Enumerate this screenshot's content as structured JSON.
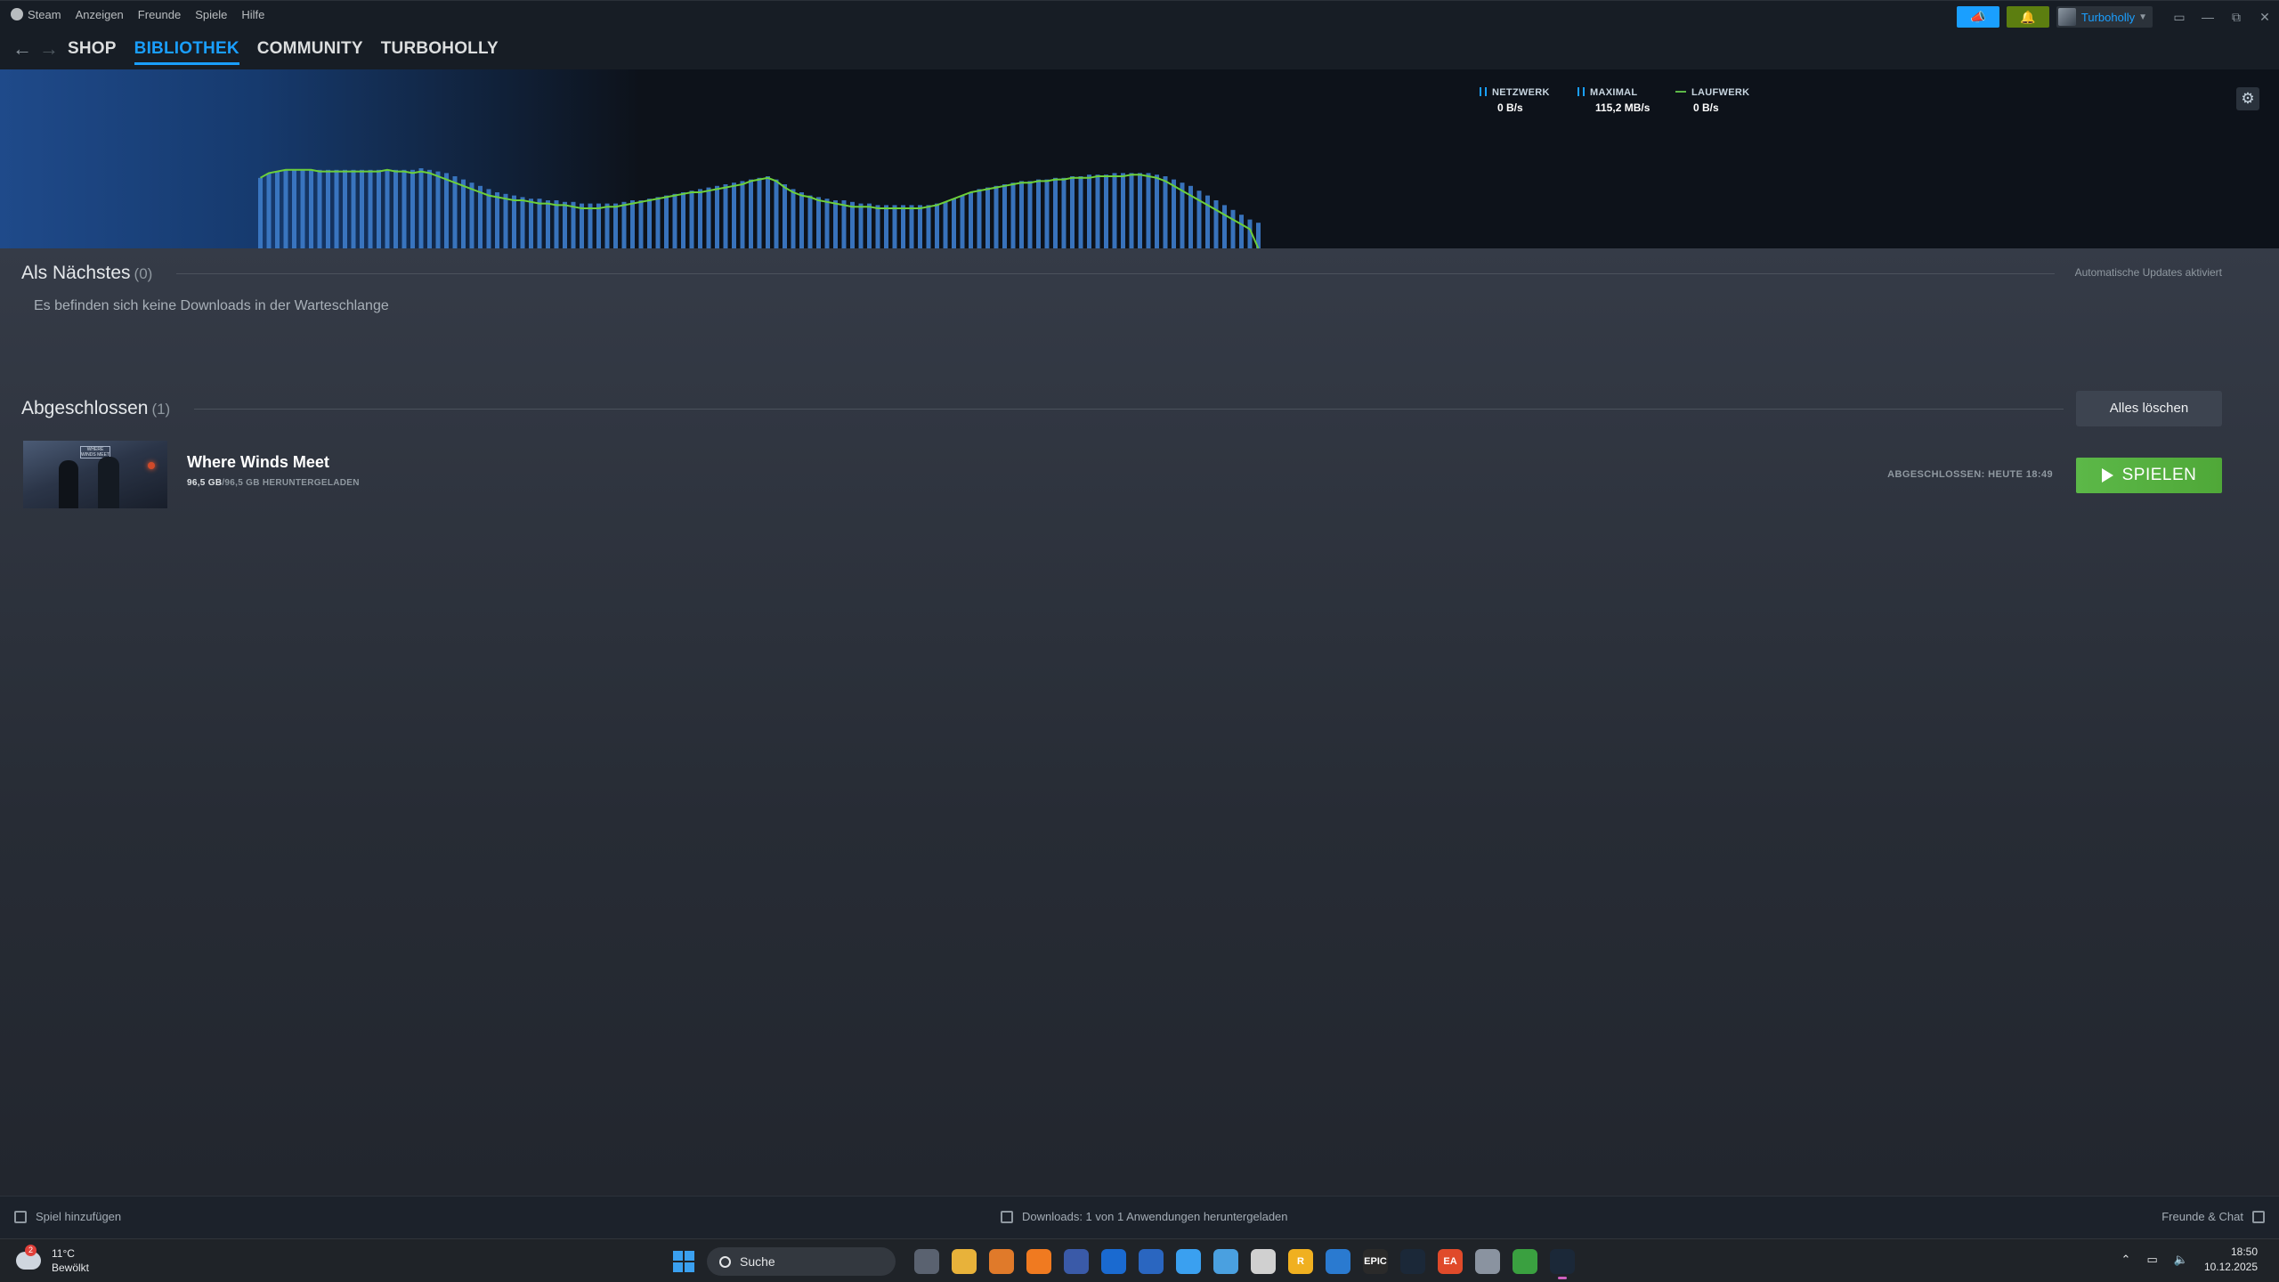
{
  "menu": {
    "steam": "Steam",
    "items": [
      "Anzeigen",
      "Freunde",
      "Spiele",
      "Hilfe"
    ]
  },
  "user": {
    "name": "Turboholly"
  },
  "nav": {
    "tabs": [
      "SHOP",
      "BIBLIOTHEK",
      "COMMUNITY",
      "TURBOHOLLY"
    ],
    "active": "BIBLIOTHEK"
  },
  "graph": {
    "legend": [
      {
        "label": "NETZWERK",
        "value": "0 B/s",
        "color": "#1a9fff"
      },
      {
        "label": "MAXIMAL",
        "value": "115,2 MB/s",
        "color": "#1a9fff"
      },
      {
        "label": "LAUFWERK",
        "value": "0 B/s",
        "color": "#5cb848"
      }
    ],
    "network_levels": [
      0.44,
      0.47,
      0.48,
      0.49,
      0.49,
      0.49,
      0.49,
      0.49,
      0.49,
      0.49,
      0.49,
      0.49,
      0.49,
      0.49,
      0.49,
      0.49,
      0.49,
      0.49,
      0.49,
      0.5,
      0.49,
      0.48,
      0.47,
      0.45,
      0.43,
      0.41,
      0.39,
      0.37,
      0.35,
      0.34,
      0.33,
      0.32,
      0.31,
      0.31,
      0.3,
      0.3,
      0.29,
      0.29,
      0.28,
      0.28,
      0.28,
      0.28,
      0.28,
      0.29,
      0.3,
      0.3,
      0.31,
      0.32,
      0.33,
      0.34,
      0.35,
      0.36,
      0.37,
      0.38,
      0.39,
      0.4,
      0.41,
      0.42,
      0.43,
      0.44,
      0.45,
      0.43,
      0.4,
      0.37,
      0.35,
      0.33,
      0.32,
      0.31,
      0.3,
      0.3,
      0.29,
      0.28,
      0.28,
      0.27,
      0.27,
      0.27,
      0.27,
      0.27,
      0.27,
      0.27,
      0.28,
      0.29,
      0.31,
      0.33,
      0.35,
      0.37,
      0.38,
      0.39,
      0.4,
      0.41,
      0.42,
      0.42,
      0.43,
      0.43,
      0.44,
      0.44,
      0.45,
      0.45,
      0.46,
      0.46,
      0.46,
      0.47,
      0.47,
      0.47,
      0.47,
      0.47,
      0.46,
      0.45,
      0.43,
      0.41,
      0.39,
      0.36,
      0.33,
      0.3,
      0.27,
      0.24,
      0.21,
      0.18,
      0.16
    ],
    "disk_levels": [
      0.44,
      0.47,
      0.48,
      0.49,
      0.49,
      0.49,
      0.49,
      0.48,
      0.48,
      0.48,
      0.48,
      0.48,
      0.48,
      0.48,
      0.48,
      0.49,
      0.48,
      0.48,
      0.47,
      0.48,
      0.47,
      0.45,
      0.43,
      0.41,
      0.39,
      0.37,
      0.35,
      0.33,
      0.32,
      0.31,
      0.3,
      0.3,
      0.29,
      0.28,
      0.28,
      0.27,
      0.27,
      0.26,
      0.25,
      0.25,
      0.25,
      0.26,
      0.26,
      0.27,
      0.28,
      0.29,
      0.3,
      0.31,
      0.32,
      0.33,
      0.34,
      0.35,
      0.35,
      0.36,
      0.37,
      0.38,
      0.39,
      0.4,
      0.42,
      0.43,
      0.44,
      0.42,
      0.38,
      0.35,
      0.33,
      0.32,
      0.3,
      0.29,
      0.28,
      0.27,
      0.26,
      0.26,
      0.26,
      0.25,
      0.25,
      0.25,
      0.25,
      0.25,
      0.25,
      0.26,
      0.27,
      0.29,
      0.31,
      0.33,
      0.35,
      0.36,
      0.37,
      0.38,
      0.39,
      0.4,
      0.41,
      0.41,
      0.42,
      0.42,
      0.43,
      0.43,
      0.44,
      0.44,
      0.44,
      0.45,
      0.45,
      0.45,
      0.45,
      0.46,
      0.46,
      0.45,
      0.44,
      0.42,
      0.39,
      0.36,
      0.33,
      0.3,
      0.27,
      0.24,
      0.21,
      0.18,
      0.15,
      0.12,
      0.0
    ]
  },
  "queue": {
    "title": "Als Nächstes",
    "count": "(0)",
    "auto_updates": "Automatische Updates aktiviert",
    "empty": "Es befinden sich keine Downloads in der Warteschlange"
  },
  "completed": {
    "title": "Abgeschlossen",
    "count": "(1)",
    "clear_label": "Alles löschen",
    "item": {
      "name": "Where Winds Meet",
      "size_done": "96,5 GB",
      "size_rest": "/96,5 GB HERUNTERGELADEN",
      "status": "ABGESCHLOSSEN: HEUTE 18:49",
      "play_label": "SPIELEN",
      "thumb_text": "WHERE WINDS MEET"
    }
  },
  "status": {
    "add_game": "Spiel hinzufügen",
    "downloads": "Downloads: 1 von 1 Anwendungen heruntergeladen",
    "friends": "Freunde & Chat"
  },
  "taskbar": {
    "weather_temp": "11°C",
    "weather_desc": "Bewölkt",
    "weather_badge": "2",
    "search_placeholder": "Suche",
    "apps": [
      {
        "name": "task-view",
        "color": "#5a6270",
        "label": ""
      },
      {
        "name": "file-explorer",
        "color": "#e8b23a",
        "label": ""
      },
      {
        "name": "browser-orange",
        "color": "#e07a2a",
        "label": ""
      },
      {
        "name": "avast",
        "color": "#f07a20",
        "label": ""
      },
      {
        "name": "news",
        "color": "#3a5aa8",
        "label": ""
      },
      {
        "name": "outlook",
        "color": "#1a6ad0",
        "label": ""
      },
      {
        "name": "editor",
        "color": "#2a66c0",
        "label": ""
      },
      {
        "name": "store",
        "color": "#3aa0f0",
        "label": ""
      },
      {
        "name": "mail",
        "color": "#4aa0e0",
        "label": ""
      },
      {
        "name": "chrome",
        "color": "#d0d0d0",
        "label": ""
      },
      {
        "name": "rockstar",
        "color": "#f0b020",
        "label": "R"
      },
      {
        "name": "ubisoft",
        "color": "#2a7ad0",
        "label": ""
      },
      {
        "name": "epic",
        "color": "#2a2a2a",
        "label": "EPIC"
      },
      {
        "name": "steam",
        "color": "#1b2838",
        "label": ""
      },
      {
        "name": "ea",
        "color": "#e04a2a",
        "label": "EA"
      },
      {
        "name": "settings",
        "color": "#8a93a0",
        "label": ""
      },
      {
        "name": "xbox",
        "color": "#3aa040",
        "label": ""
      },
      {
        "name": "steam-active",
        "color": "#1b2838",
        "label": ""
      }
    ],
    "time": "18:50",
    "date": "10.12.2025"
  }
}
